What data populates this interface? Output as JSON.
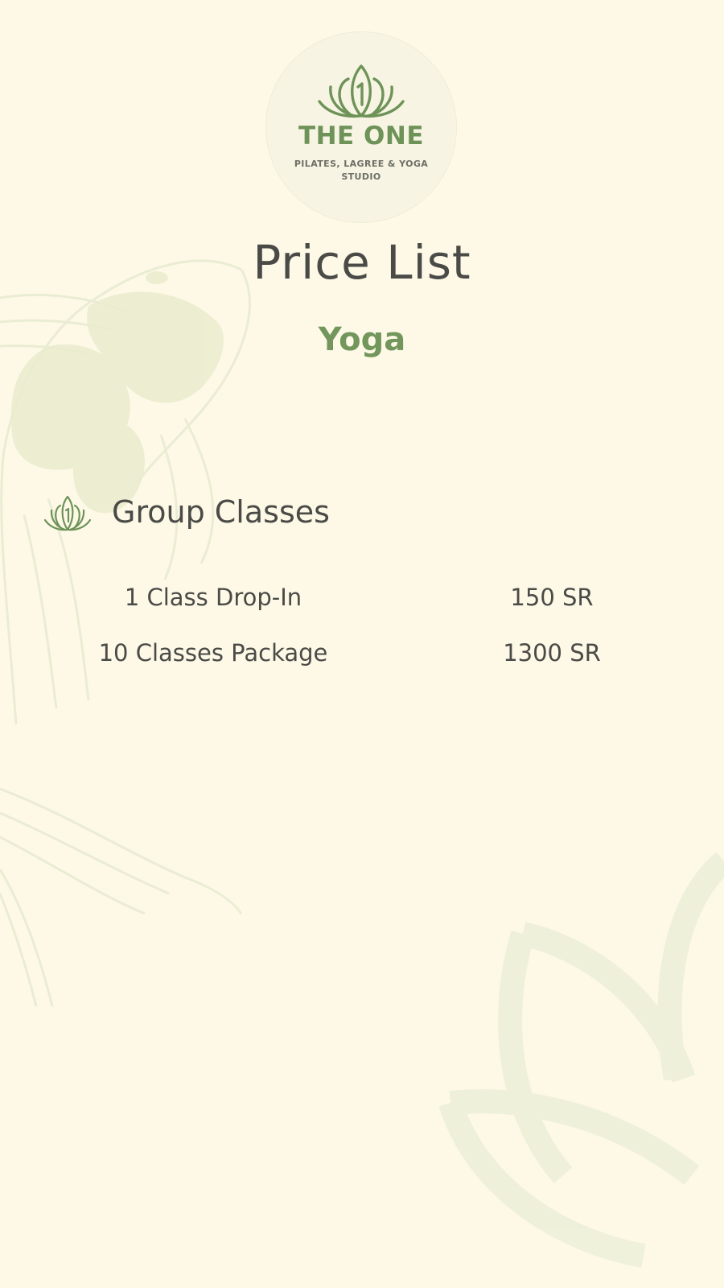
{
  "brand": {
    "name": "THE ONE",
    "tagline_line1": "PILATES, LAGREE & YOGA",
    "tagline_line2": "STUDIO",
    "logo_icon": "lotus-icon",
    "accent_color": "#72965c"
  },
  "page": {
    "title": "Price List",
    "subtitle": "Yoga",
    "background_color": "#fdf9e6"
  },
  "section": {
    "icon": "lotus-icon",
    "title": "Group Classes",
    "items": [
      {
        "name": "1 Class Drop-In",
        "price": "150 SR"
      },
      {
        "name": "10 Classes Package",
        "price": "1300 SR"
      }
    ]
  }
}
